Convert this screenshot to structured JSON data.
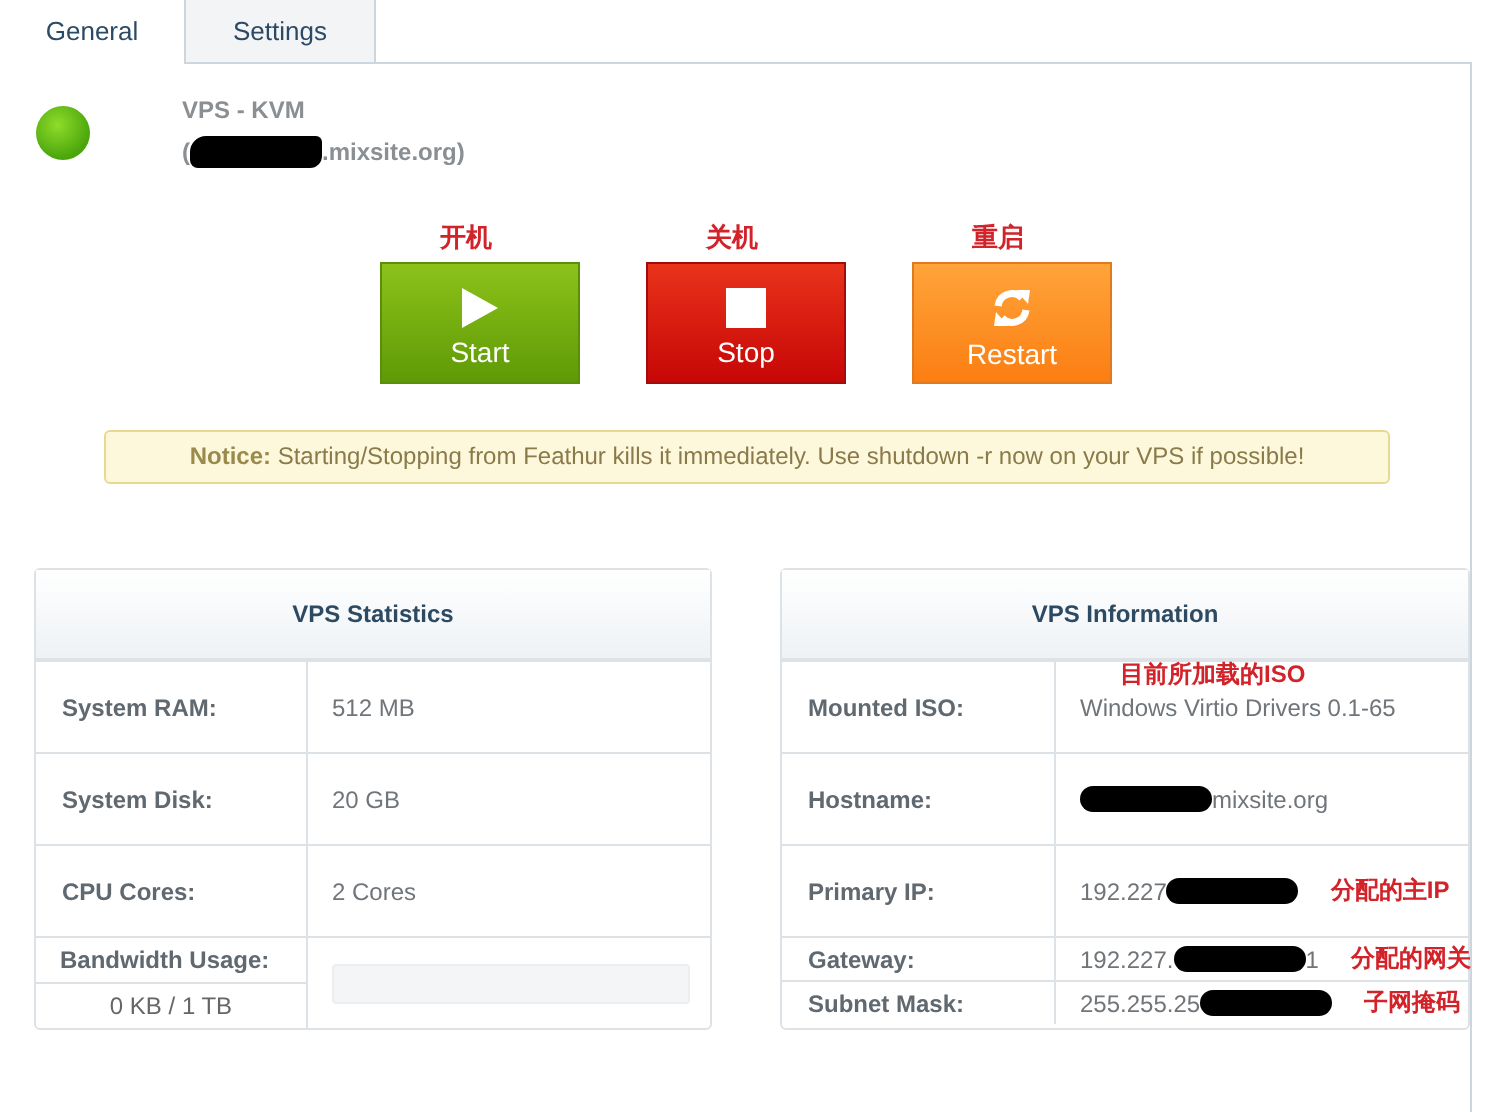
{
  "tabs": [
    {
      "label": "General",
      "selected": true
    },
    {
      "label": "Settings",
      "selected": false
    }
  ],
  "server": {
    "type": "VPS - KVM",
    "hostname": [
      {
        "kind": "text",
        "text": "("
      },
      {
        "kind": "redaction"
      },
      {
        "kind": "text",
        "text": ".mixsite.org)"
      }
    ]
  },
  "power_buttons": [
    {
      "kind": "start",
      "label": "Start",
      "annotation": "开机"
    },
    {
      "kind": "stop",
      "label": "Stop",
      "annotation": "关机"
    },
    {
      "kind": "restart",
      "label": "Restart",
      "annotation": "重启"
    }
  ],
  "notice": {
    "text": "**Notice:** Starting/Stopping from Feathur kills it immediately. Use shutdown -r now on your VPS if possible!"
  },
  "statistics": {
    "title": "VPS Statistics",
    "rows": [
      {
        "kind": "plain",
        "label": "System RAM:",
        "parts": [
          {
            "kind": "text",
            "text": "512 MB"
          }
        ]
      },
      {
        "kind": "plain",
        "label": "System Disk:",
        "parts": [
          {
            "kind": "text",
            "text": "20 GB"
          }
        ]
      },
      {
        "kind": "plain",
        "label": "CPU Cores:",
        "parts": [
          {
            "kind": "text",
            "text": "2 Cores"
          }
        ]
      },
      {
        "kind": "bandwidth",
        "label": "Bandwidth Usage:",
        "reading": "0 KB / 1 TB",
        "level": 0
      }
    ]
  },
  "information": {
    "title": "VPS Information",
    "rows": [
      {
        "kind": "plain",
        "label": "Mounted ISO:",
        "parts": [
          {
            "kind": "text",
            "text": "Windows Virtio Drivers 0.1-65"
          }
        ],
        "annotation": {
          "kind": "above",
          "text": "目前所加载的ISO"
        }
      },
      {
        "kind": "plain",
        "label": "Hostname:",
        "parts": [
          {
            "kind": "redaction"
          },
          {
            "kind": "text",
            "text": "mixsite.org"
          }
        ]
      },
      {
        "kind": "plain",
        "label": "Primary IP:",
        "parts": [
          {
            "kind": "text",
            "text": "192.227"
          },
          {
            "kind": "redaction"
          }
        ],
        "annotation": {
          "kind": "right",
          "text": "分配的主IP"
        }
      },
      {
        "kind": "short",
        "label": "Gateway:",
        "parts": [
          {
            "kind": "text",
            "text": "192.227."
          },
          {
            "kind": "redaction"
          },
          {
            "kind": "text",
            "text": "1"
          }
        ],
        "annotation": {
          "kind": "right",
          "text": "分配的网关"
        }
      },
      {
        "kind": "short",
        "label": "Subnet Mask:",
        "parts": [
          {
            "kind": "text",
            "text": "255.255.25"
          },
          {
            "kind": "redaction"
          }
        ],
        "annotation": {
          "kind": "right",
          "text": "子网掩码"
        }
      }
    ]
  }
}
